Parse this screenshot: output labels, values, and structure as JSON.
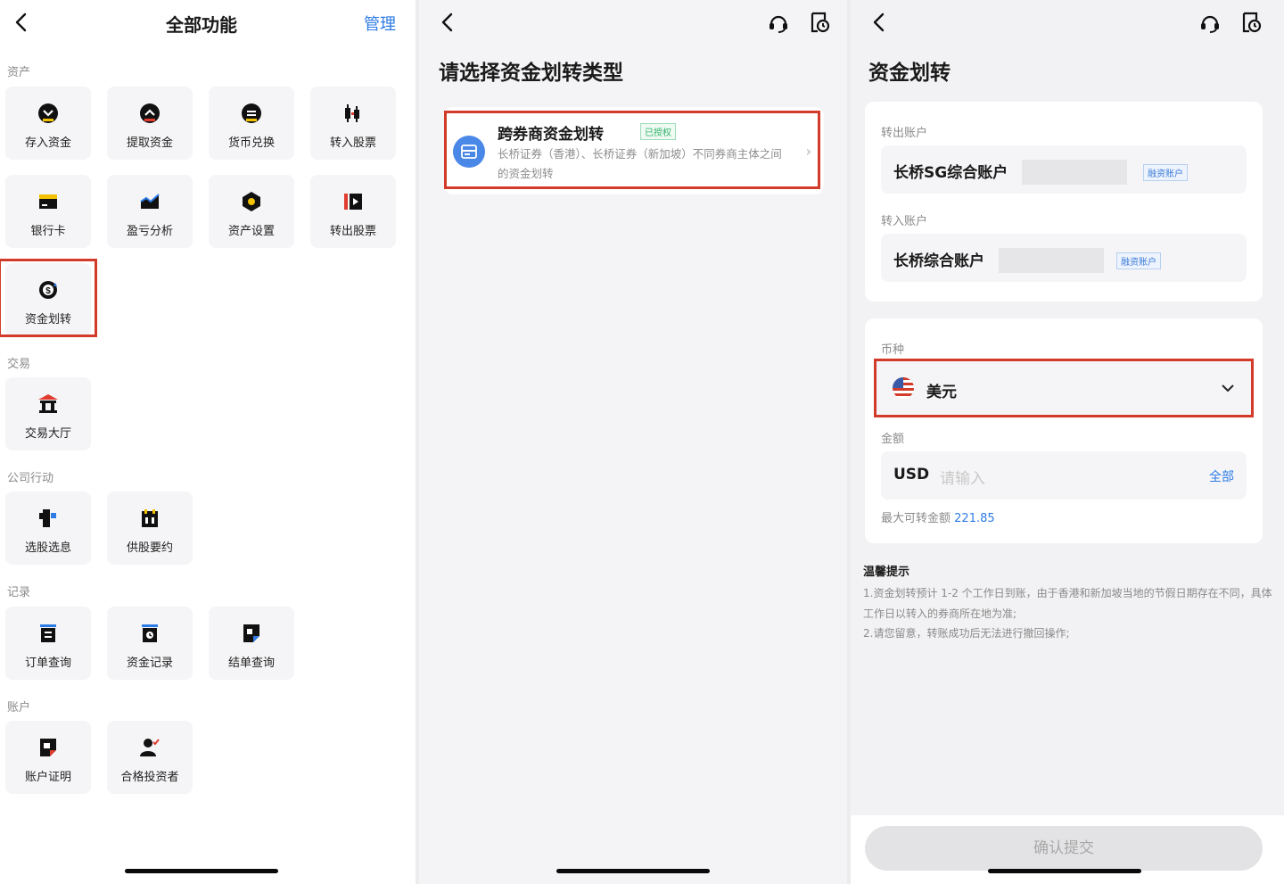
{
  "panel1": {
    "title": "全部功能",
    "manage": "管理",
    "sections": {
      "assets": "资产",
      "trade": "交易",
      "corporate": "公司行动",
      "records": "记录",
      "account": "账户"
    },
    "tiles": {
      "deposit": {
        "label": "存入资金",
        "icon": "deposit-icon"
      },
      "withdraw": {
        "label": "提取资金",
        "icon": "withdraw-icon"
      },
      "fx": {
        "label": "货币兑换",
        "icon": "currency-exchange-icon"
      },
      "stock_in": {
        "label": "转入股票",
        "icon": "stock-in-icon"
      },
      "bank_card": {
        "label": "银行卡",
        "icon": "bank-card-icon"
      },
      "pnl": {
        "label": "盈亏分析",
        "icon": "chart-icon"
      },
      "asset_settings": {
        "label": "资产设置",
        "icon": "settings-icon"
      },
      "stock_out": {
        "label": "转出股票",
        "icon": "stock-out-icon"
      },
      "fund_transfer": {
        "label": "资金划转",
        "icon": "dollar-transfer-icon"
      },
      "trade_hall": {
        "label": "交易大厅",
        "icon": "bank-building-icon"
      },
      "stock_options": {
        "label": "选股选息",
        "icon": "stock-option-icon"
      },
      "tender_offer": {
        "label": "供股要约",
        "icon": "calendar-icon"
      },
      "order_query": {
        "label": "订单查询",
        "icon": "order-icon"
      },
      "fund_records": {
        "label": "资金记录",
        "icon": "record-icon"
      },
      "statement": {
        "label": "结单查询",
        "icon": "statement-icon"
      },
      "account_proof": {
        "label": "账户证明",
        "icon": "certificate-icon"
      },
      "qualified_investor": {
        "label": "合格投资者",
        "icon": "investor-icon"
      }
    }
  },
  "panel2": {
    "title": "请选择资金划转类型",
    "option": {
      "title": "跨券商资金划转",
      "badge": "已授权",
      "desc": "长桥证券（香港）、长桥证券（新加坡）不同券商主体之间的资金划转"
    }
  },
  "panel3": {
    "title": "资金划转",
    "out_label": "转出账户",
    "out_account": "长桥SG综合账户",
    "out_tag": "融资账户",
    "in_label": "转入账户",
    "in_account": "长桥综合账户",
    "in_tag": "融资账户",
    "currency_label": "币种",
    "currency": "美元",
    "amount_label": "金额",
    "amount_unit": "USD",
    "amount_placeholder": "请输入",
    "all": "全部",
    "max_label": "最大可转金额",
    "max_value": "221.85",
    "tips_title": "温馨提示",
    "tips_1": "1.资金划转预计 1-2 个工作日到账，由于香港和新加坡当地的节假日期存在不同，具体工作日以转入的券商所在地为准;",
    "tips_2": "2.请您留意，转账成功后无法进行撤回操作;",
    "submit": "确认提交"
  },
  "colors": {
    "accent": "#2d7be5",
    "highlight": "#d23b2a",
    "tile_icon": "#111111",
    "tile_accent": "#f2c200"
  }
}
